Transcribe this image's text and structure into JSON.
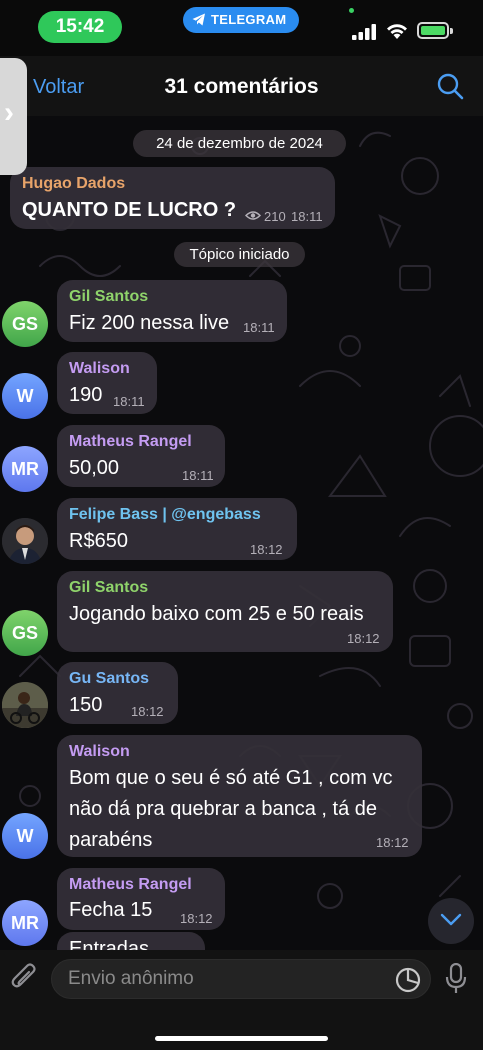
{
  "status_bar": {
    "time": "15:42",
    "app_pill": "TELEGRAM"
  },
  "nav": {
    "back": "Voltar",
    "title": "31 comentários",
    "search_icon": "search-icon"
  },
  "chat": {
    "date": "24 de dezembro de 2024",
    "topic_started": "Tópico iniciado",
    "post": {
      "author": "Hugao Dados",
      "text": "QUANTO DE LUCRO ?",
      "views": "210",
      "time": "18:11"
    },
    "messages": [
      {
        "author": "Gil Santos",
        "initials": "GS",
        "lines": [
          "Fiz 200 nessa live"
        ],
        "time": "18:11"
      },
      {
        "author": "Walison",
        "initials": "W",
        "lines": [
          "190"
        ],
        "time": "18:11"
      },
      {
        "author": "Matheus Rangel",
        "initials": "MR",
        "lines": [
          "50,00"
        ],
        "time": "18:11"
      },
      {
        "author": "Felipe Bass | @engebass",
        "initials": "",
        "lines": [
          "R$650"
        ],
        "time": "18:12"
      },
      {
        "author": "Gil Santos",
        "initials": "GS",
        "lines": [
          "Jogando baixo com 25 e 50 reais"
        ],
        "time": "18:12"
      },
      {
        "author": "Gu Santos",
        "initials": "",
        "lines": [
          "150"
        ],
        "time": "18:12"
      },
      {
        "author": "Walison",
        "initials": "W",
        "lines": [
          "Bom que o seu é só até G1 , com vc",
          "não dá pra quebrar a banca , tá de",
          "parabéns"
        ],
        "time": "18:12"
      },
      {
        "author": "Matheus Rangel",
        "initials": "MR",
        "lines": [
          "Fecha 15"
        ],
        "time": "18:12"
      },
      {
        "author": "",
        "initials": "",
        "lines": [
          "Entradas"
        ],
        "time": ""
      }
    ]
  },
  "composer": {
    "placeholder": "Envio anônimo"
  },
  "colors": {
    "accent": "#4b9df2",
    "name_orange": "#e8a46a",
    "name_green": "#8fd36b",
    "name_purple": "#c49cf2",
    "name_cyan": "#6fc3ef",
    "name_blue": "#77b6f5"
  }
}
